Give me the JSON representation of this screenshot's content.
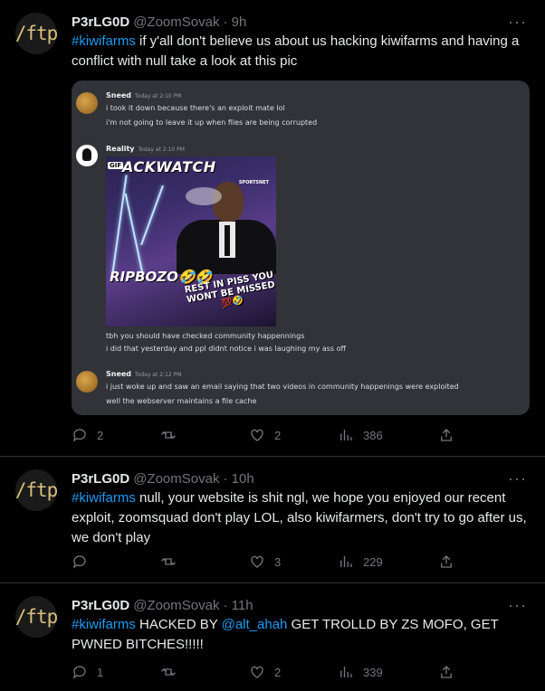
{
  "tweets": [
    {
      "avatar_text": "/ftp",
      "name": "P3rLG0D",
      "handle": "@ZoomSovak",
      "time": "· 9h",
      "text_hash": "#kiwifarms",
      "text_rest": " if y'all don't believe us about us hacking kiwifarms and having a conflict with null take a look at this pic",
      "embed": {
        "messages": [
          {
            "author": "Sneed",
            "time": "Today at 2:10 PM",
            "lines": [
              "i took it down because there's an exploit mate lol",
              "i'm not going to leave it up when files are being corrupted"
            ]
          },
          {
            "author": "Reality",
            "time": "Today at 2:10 PM",
            "gif": {
              "tag": "GIF",
              "top_text": "ACKWATCH",
              "brand": "SPORTSNET",
              "caption": "RIPBOZO🤣🤣",
              "subcaption": "REST IN PISS YOU WONT BE MISSED 💯🤣"
            },
            "lines": [
              "tbh you should have checked community happennings",
              "i did that yesterday and ppl didnt notice i was laughing my ass off"
            ]
          },
          {
            "author": "Sneed",
            "time": "Today at 2:12 PM",
            "lines": [
              "i just woke up and saw an email saying that two videos in community happenings were exploited",
              "well the webserver maintains a file cache"
            ]
          }
        ]
      },
      "stats": {
        "replies": "2",
        "retweets": "",
        "likes": "2",
        "views": "386"
      }
    },
    {
      "avatar_text": "/ftp",
      "name": "P3rLG0D",
      "handle": "@ZoomSovak",
      "time": "· 10h",
      "text_hash": "#kiwifarms",
      "text_rest": " null, your website is shit ngl, we hope you enjoyed our recent exploit, zoomsquad don't play LOL, also kiwifarmers, don't try to go after us, we don't play",
      "stats": {
        "replies": "",
        "retweets": "",
        "likes": "3",
        "views": "229"
      }
    },
    {
      "avatar_text": "/ftp",
      "name": "P3rLG0D",
      "handle": "@ZoomSovak",
      "time": "· 11h",
      "text_hash": "#kiwifarms",
      "text_mid": " HACKED BY ",
      "text_mention": "@alt_ahah",
      "text_rest": " GET TROLLD BY ZS MOFO, GET PWNED BITCHES!!!!!",
      "stats": {
        "replies": "1",
        "retweets": "",
        "likes": "2",
        "views": "339"
      }
    }
  ],
  "more_icon": "···"
}
